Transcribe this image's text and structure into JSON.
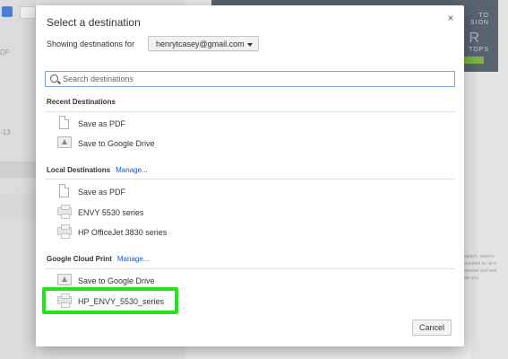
{
  "background": {
    "left_snippets": [
      "DF",
      "-13"
    ],
    "ad_text": [
      "TO",
      "SION",
      "E R",
      "TOPS"
    ],
    "side_text": "ispatch, newsro provided by se d browser and  and ask you"
  },
  "dialog": {
    "title": "Select a destination",
    "close_glyph": "×",
    "showing_label": "Showing destinations for",
    "account": "henrytcasey@gmail.com",
    "search_placeholder": "Search destinations",
    "sections": {
      "recent": {
        "title": "Recent Destinations",
        "items": [
          "Save as PDF",
          "Save to Google Drive"
        ]
      },
      "local": {
        "title": "Local Destinations",
        "manage": "Manage...",
        "items": [
          "Save as PDF",
          "ENVY 5530 series",
          "HP OfficeJet 3830 series"
        ]
      },
      "cloud": {
        "title": "Google Cloud Print",
        "manage": "Manage...",
        "items": [
          "Save to Google Drive",
          "HP_ENVY_5530_series"
        ]
      }
    },
    "cancel_label": "Cancel"
  },
  "colors": {
    "highlight": "#22e61a",
    "link": "#1a55c9",
    "search_border": "#7aa3e0"
  }
}
